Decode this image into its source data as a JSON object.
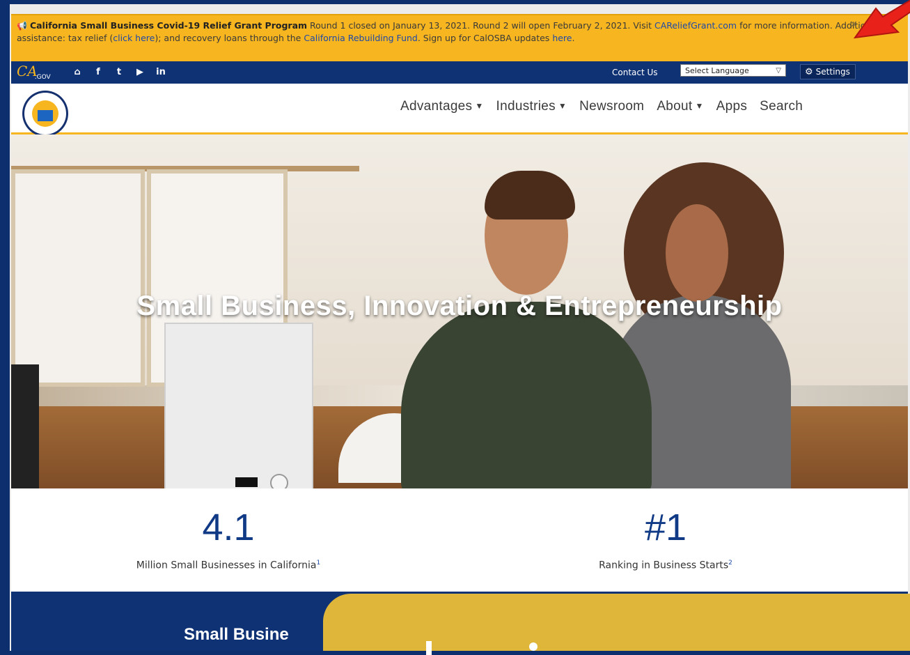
{
  "alert": {
    "title": "California Small Business Covid-19 Relief Grant Program",
    "text1": "Round 1 closed on January 13, 2021. Round 2 will open February 2, 2021. Visit",
    "link1": "CAReliefGrant.com",
    "text2": "for more information. Additional assistance: tax relief (",
    "link2": "click here",
    "text3": "); and recovery loans through the",
    "link3": "California Rebuilding Fund",
    "text4": ". Sign up for CalOSBA updates",
    "link4": "here",
    "text5": ".",
    "close": "×"
  },
  "utility": {
    "ca_logo": "CA",
    "ca_logo_sub": ".GOV",
    "social_icons": [
      "home-icon",
      "facebook-icon",
      "twitter-icon",
      "youtube-icon",
      "linkedin-icon"
    ],
    "social_glyphs": [
      "⌂",
      "f",
      "t",
      "▶",
      "in"
    ],
    "contact_us": "Contact Us",
    "language": "Select Language",
    "settings": "Settings"
  },
  "nav": {
    "items": [
      {
        "label": "Advantages",
        "dropdown": true
      },
      {
        "label": "Industries",
        "dropdown": true
      },
      {
        "label": "Newsroom",
        "dropdown": false
      },
      {
        "label": "About",
        "dropdown": true
      },
      {
        "label": "Apps",
        "dropdown": false
      },
      {
        "label": "Search",
        "dropdown": false
      }
    ]
  },
  "hero": {
    "title": "Small Business, Innovation & Entrepreneurship"
  },
  "stats": [
    {
      "value": "4.1",
      "label": "Million Small Businesses in California",
      "footnote": "1"
    },
    {
      "value": "#1",
      "label": "Ranking in Business Starts",
      "footnote": "2"
    }
  ],
  "bottom": {
    "title": "Small Busine"
  },
  "colors": {
    "alert_bg": "#f7b51f",
    "navy": "#0f3274",
    "accent_gold": "#e0b63a",
    "link_blue": "#1e4aa8",
    "annotation_red": "#e8211b"
  }
}
